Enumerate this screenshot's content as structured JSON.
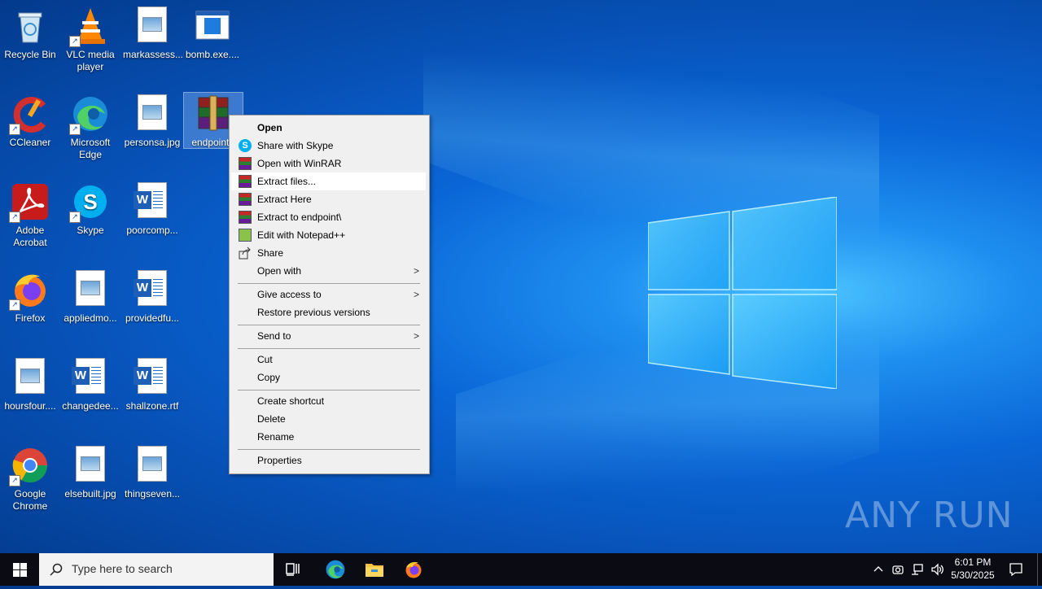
{
  "desktop": {
    "icons": [
      {
        "label": "Recycle Bin"
      },
      {
        "label": "VLC media player"
      },
      {
        "label": "markassess..."
      },
      {
        "label": "bomb.exe...."
      },
      {
        "label": "CCleaner"
      },
      {
        "label": "Microsoft Edge"
      },
      {
        "label": "personsa.jpg"
      },
      {
        "label": "endpoint.r"
      },
      {
        "label": "Adobe Acrobat"
      },
      {
        "label": "Skype"
      },
      {
        "label": "poorcomp..."
      },
      {
        "label": "Firefox"
      },
      {
        "label": "appliedmo..."
      },
      {
        "label": "providedfu..."
      },
      {
        "label": "hoursfour...."
      },
      {
        "label": "changedee..."
      },
      {
        "label": "shallzone.rtf"
      },
      {
        "label": "Google Chrome"
      },
      {
        "label": "elsebuilt.jpg"
      },
      {
        "label": "thingseven..."
      }
    ]
  },
  "context_menu": {
    "items": [
      {
        "label": "Open"
      },
      {
        "label": "Share with Skype"
      },
      {
        "label": "Open with WinRAR"
      },
      {
        "label": "Extract files..."
      },
      {
        "label": "Extract Here"
      },
      {
        "label": "Extract to endpoint\\"
      },
      {
        "label": "Edit with Notepad++"
      },
      {
        "label": "Share"
      },
      {
        "label": "Open with"
      },
      {
        "label": "Give access to"
      },
      {
        "label": "Restore previous versions"
      },
      {
        "label": "Send to"
      },
      {
        "label": "Cut"
      },
      {
        "label": "Copy"
      },
      {
        "label": "Create shortcut"
      },
      {
        "label": "Delete"
      },
      {
        "label": "Rename"
      },
      {
        "label": "Properties"
      }
    ],
    "highlighted": "Extract files..."
  },
  "taskbar": {
    "search_placeholder": "Type here to search",
    "time": "6:01 PM",
    "date": "5/30/2025"
  },
  "watermark": "ANY RUN"
}
